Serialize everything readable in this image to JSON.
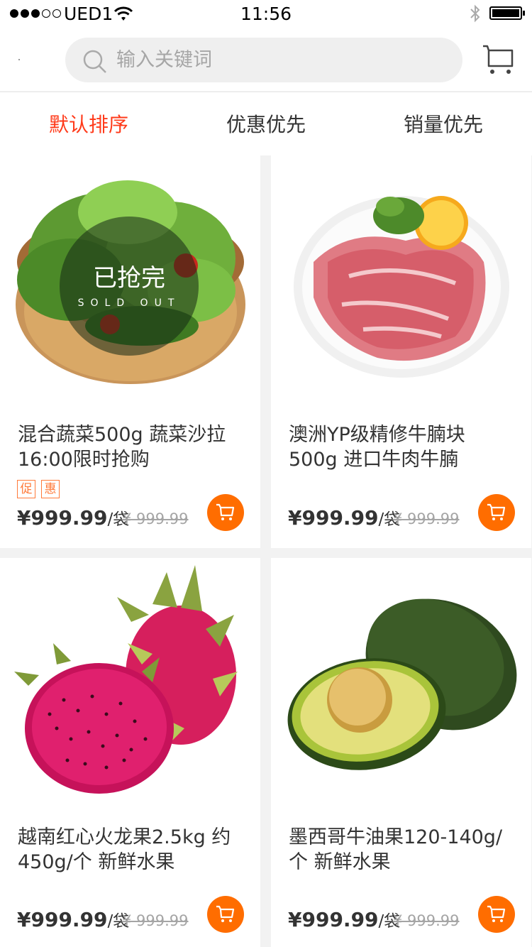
{
  "status_bar": {
    "carrier": "UED1",
    "time": "11:56"
  },
  "search": {
    "placeholder": "输入关键词",
    "icon": "search-icon"
  },
  "sort_tabs": [
    {
      "label": "默认排序",
      "active": true
    },
    {
      "label": "优惠优先",
      "active": false
    },
    {
      "label": "销量优先",
      "active": false
    }
  ],
  "colors": {
    "accent": "#ff3a1a",
    "cart_button": "#ff6d00",
    "tag": "#ff7a3a"
  },
  "soldout_badge": {
    "title": "已抢完",
    "subtitle": "SOLD OUT"
  },
  "products": [
    {
      "title": "混合蔬菜500g 蔬菜沙拉 16:00限时抢购",
      "tags": [
        "促",
        "惠"
      ],
      "price": "¥999.99",
      "unit": "/袋",
      "old_price": "¥ 999.99",
      "sold_out": true,
      "image": "salad-bowl"
    },
    {
      "title": "澳洲YP级精修牛腩块 500g 进口牛肉牛腩",
      "tags": [],
      "price": "¥999.99",
      "unit": "/袋",
      "old_price": "¥ 999.99",
      "sold_out": false,
      "image": "beef-plate"
    },
    {
      "title": "越南红心火龙果2.5kg 约450g/个 新鲜水果",
      "tags": [],
      "price": "¥999.99",
      "unit": "/袋",
      "old_price": "¥ 999.99",
      "sold_out": false,
      "image": "dragon-fruit"
    },
    {
      "title": "墨西哥牛油果120-140g/个 新鲜水果",
      "tags": [],
      "price": "¥999.99",
      "unit": "/袋",
      "old_price": "¥ 999.99",
      "sold_out": false,
      "image": "avocado"
    }
  ]
}
